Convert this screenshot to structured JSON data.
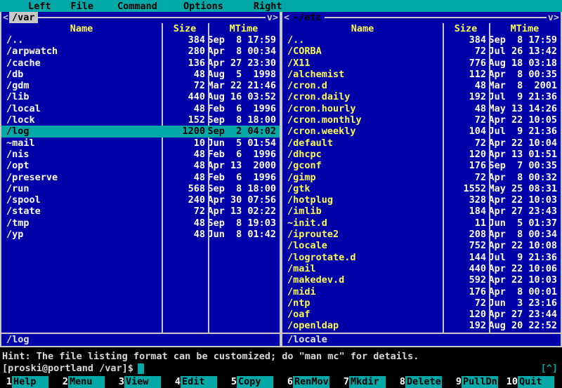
{
  "colors": {
    "panel_blue": "#0000A8",
    "bar_cyan": "#00A8A8",
    "frame_white": "#C8C8C8",
    "header_yellow": "#FCFC54",
    "file_text_white": "#FFFFFF",
    "selected_bg": "#00A8A8",
    "selected_fg": "#000000",
    "terminal_bg": "#000000"
  },
  "menu_bar": {
    "items": [
      "Left",
      "File",
      "Command",
      "Options",
      "Right"
    ]
  },
  "panels": [
    {
      "title": "/var",
      "active": true,
      "left_arrow": "<",
      "right_arrow": "v>",
      "columns": {
        "name": "Name",
        "size": "Size",
        "mtime": "MTime"
      },
      "mini_status": "/log",
      "files": [
        {
          "name": "/..",
          "size": "384",
          "mtime": "Sep  8 17:59"
        },
        {
          "name": "/arpwatch",
          "size": "280",
          "mtime": "Apr  8 00:34"
        },
        {
          "name": "/cache",
          "size": "136",
          "mtime": "Apr 27 23:30"
        },
        {
          "name": "/db",
          "size": "48",
          "mtime": "Aug  5  1998"
        },
        {
          "name": "/gdm",
          "size": "72",
          "mtime": "Mar 22 21:46"
        },
        {
          "name": "/lib",
          "size": "440",
          "mtime": "Aug 16 03:52"
        },
        {
          "name": "/local",
          "size": "48",
          "mtime": "Feb  6  1996"
        },
        {
          "name": "/lock",
          "size": "152",
          "mtime": "Sep  8 18:00"
        },
        {
          "name": "/log",
          "size": "1200",
          "mtime": "Sep  2 04:02",
          "selected": true
        },
        {
          "name": "~mail",
          "size": "10",
          "mtime": "Jun  5 01:54"
        },
        {
          "name": "/nis",
          "size": "48",
          "mtime": "Feb  6  1996"
        },
        {
          "name": "/opt",
          "size": "48",
          "mtime": "Apr 13  2000"
        },
        {
          "name": "/preserve",
          "size": "48",
          "mtime": "Feb  6  1996"
        },
        {
          "name": "/run",
          "size": "568",
          "mtime": "Sep  8 18:00"
        },
        {
          "name": "/spool",
          "size": "240",
          "mtime": "Apr 30 07:56"
        },
        {
          "name": "/state",
          "size": "72",
          "mtime": "Apr 13 02:22"
        },
        {
          "name": "/tmp",
          "size": "48",
          "mtime": "Sep  8 19:03"
        },
        {
          "name": "/yp",
          "size": "48",
          "mtime": "Jun  8 01:42"
        }
      ]
    },
    {
      "title": "-/etc",
      "active": false,
      "left_arrow": "<",
      "right_arrow": "v>",
      "columns": {
        "name": "Name",
        "size": "Size",
        "mtime": "MTime"
      },
      "mini_status": "/locale",
      "files": [
        {
          "name": "/..",
          "size": "384",
          "mtime": "Sep  8 17:59"
        },
        {
          "name": "/CORBA",
          "size": "72",
          "mtime": "Jul 26 13:42"
        },
        {
          "name": "/X11",
          "size": "776",
          "mtime": "Aug 18 03:18"
        },
        {
          "name": "/alchemist",
          "size": "112",
          "mtime": "Apr  8 00:35"
        },
        {
          "name": "/cron.d",
          "size": "48",
          "mtime": "Mar  8  2001"
        },
        {
          "name": "/cron.daily",
          "size": "192",
          "mtime": "Jul  9 21:36"
        },
        {
          "name": "/cron.hourly",
          "size": "48",
          "mtime": "May 13 14:26"
        },
        {
          "name": "/cron.monthly",
          "size": "72",
          "mtime": "Apr 22 10:05"
        },
        {
          "name": "/cron.weekly",
          "size": "104",
          "mtime": "Jul  9 21:36"
        },
        {
          "name": "/default",
          "size": "72",
          "mtime": "Apr 22 10:04"
        },
        {
          "name": "/dhcpc",
          "size": "120",
          "mtime": "Apr 13 01:51"
        },
        {
          "name": "/gconf",
          "size": "176",
          "mtime": "Sep  7 00:35"
        },
        {
          "name": "/gimp",
          "size": "72",
          "mtime": "Apr  8 00:32"
        },
        {
          "name": "/gtk",
          "size": "1552",
          "mtime": "May 25 08:31"
        },
        {
          "name": "/hotplug",
          "size": "328",
          "mtime": "Apr 22 10:03"
        },
        {
          "name": "/imlib",
          "size": "184",
          "mtime": "Apr 27 23:43"
        },
        {
          "name": "~init.d",
          "size": "11",
          "mtime": "Jun  5 01:37"
        },
        {
          "name": "/iproute2",
          "size": "208",
          "mtime": "Apr  8 00:34"
        },
        {
          "name": "/locale",
          "size": "752",
          "mtime": "Apr 22 10:08"
        },
        {
          "name": "/logrotate.d",
          "size": "144",
          "mtime": "Jul  9 21:36"
        },
        {
          "name": "/mail",
          "size": "440",
          "mtime": "Apr 22 10:06"
        },
        {
          "name": "/makedev.d",
          "size": "592",
          "mtime": "Apr 22 10:03"
        },
        {
          "name": "/midi",
          "size": "176",
          "mtime": "Apr  8 00:01"
        },
        {
          "name": "/ntp",
          "size": "72",
          "mtime": "Jun  3 23:16"
        },
        {
          "name": "/oaf",
          "size": "120",
          "mtime": "Apr 27 23:44"
        },
        {
          "name": "/openldap",
          "size": "192",
          "mtime": "Aug 20 22:52"
        }
      ]
    }
  ],
  "hint_line": "Hint: The file listing format can be customized; do \"man mc\" for details.",
  "command_line": {
    "prompt": "[proski@portland /var]$",
    "scroll_indicator": "[^]"
  },
  "function_keys": [
    {
      "num": "1",
      "label": "Help"
    },
    {
      "num": "2",
      "label": "Menu"
    },
    {
      "num": "3",
      "label": "View"
    },
    {
      "num": "4",
      "label": "Edit"
    },
    {
      "num": "5",
      "label": "Copy"
    },
    {
      "num": "6",
      "label": "RenMov"
    },
    {
      "num": "7",
      "label": "Mkdir"
    },
    {
      "num": "8",
      "label": "Delete"
    },
    {
      "num": "9",
      "label": "PullDn"
    },
    {
      "num": "10",
      "label": "Quit"
    }
  ]
}
